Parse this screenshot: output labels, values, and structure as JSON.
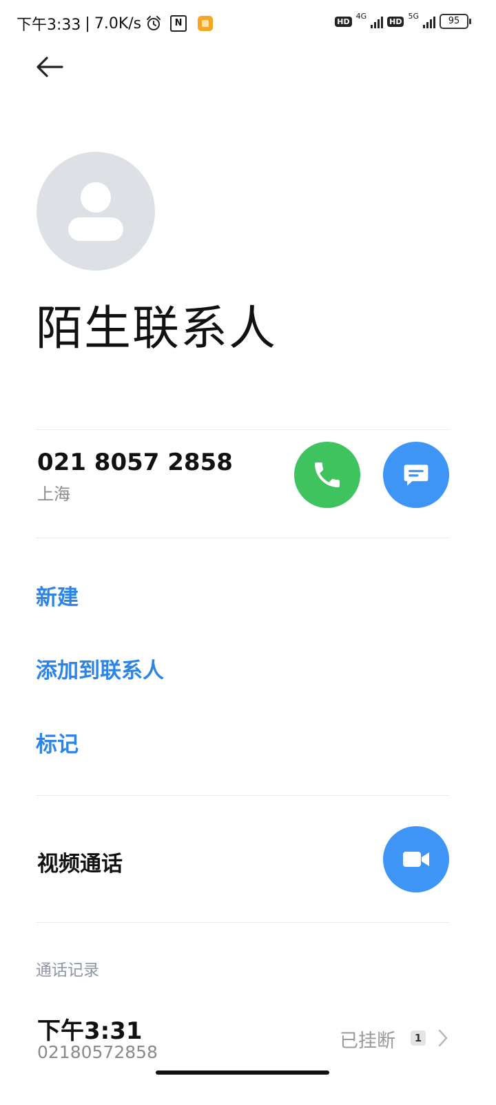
{
  "status_bar": {
    "time": "下午3:33",
    "separator": "|",
    "network_speed": "7.0K/s",
    "icons": [
      "alarm-icon",
      "nfc-icon",
      "app-notification-icon"
    ],
    "hd_1": "HD",
    "network_1": "4G",
    "hd_2": "HD",
    "network_2": "5G",
    "battery": "95"
  },
  "header": {
    "back_icon": "arrow-left-icon"
  },
  "contact": {
    "name": "陌生联系人",
    "phone_number": "021 8057 2858",
    "location": "上海"
  },
  "actions": {
    "new": "新建",
    "add_to_contacts": "添加到联系人",
    "mark": "标记"
  },
  "video_call": {
    "label": "视频通话"
  },
  "call_log": {
    "section_title": "通话记录",
    "entries": [
      {
        "time": "下午3:31",
        "number": "02180572858",
        "status": "已挂断",
        "count": "1"
      }
    ]
  },
  "colors": {
    "accent_blue": "#2c85e6",
    "call_green": "#3ec35f",
    "button_blue": "#3e95f5",
    "avatar_gray": "#dde0e4"
  }
}
